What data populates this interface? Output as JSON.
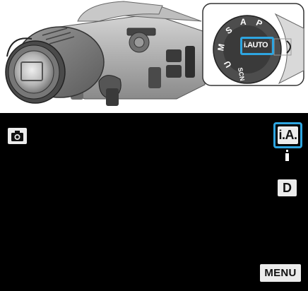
{
  "illustration": {
    "dial": {
      "marks": [
        "S",
        "A",
        "P",
        "M",
        "U",
        "SCN"
      ],
      "selected_label": "i.AUTO",
      "highlight_color": "#2ea5e0"
    }
  },
  "screen": {
    "mode_icon": "camera-icon",
    "intelligent_auto_label": "i.A.",
    "d_label": "D",
    "menu_label": "MENU",
    "accent_color": "#2ea5e0"
  }
}
